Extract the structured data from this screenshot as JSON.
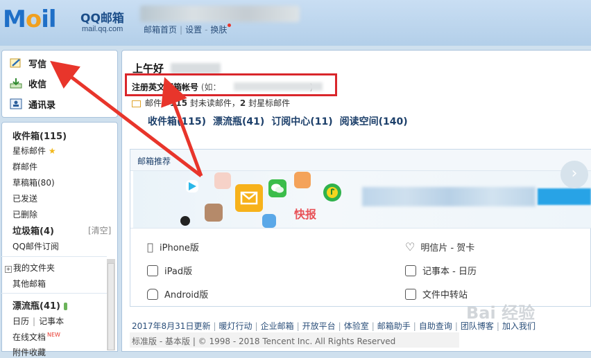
{
  "header": {
    "logo_text_main": "M",
    "logo_text_o": "o",
    "logo_text_il": "il",
    "logo_qq": "QQ邮箱",
    "logo_url": "mail.qq.com",
    "nav": {
      "home": "邮箱首页",
      "settings": "设置",
      "skin": "换肤"
    }
  },
  "sidebar": {
    "write": "写信",
    "receive": "收信",
    "contacts": "通讯录",
    "folders": [
      {
        "label": "收件箱(115)",
        "bold": true
      },
      {
        "label": "星标邮件",
        "bold": false
      },
      {
        "label": "群邮件",
        "bold": false
      },
      {
        "label": "草稿箱(80)",
        "bold": false
      },
      {
        "label": "已发送",
        "bold": false
      },
      {
        "label": "已删除",
        "bold": false
      },
      {
        "label": "垃圾箱(4)",
        "bold": true
      },
      {
        "label": "QQ邮件订阅",
        "bold": false
      }
    ],
    "clear_label": "[清空]",
    "my_folders": "我的文件夹",
    "other_mailbox": "其他邮箱",
    "drift_bottle": "漂流瓶(41)",
    "calendar": "日历",
    "notes": "记事本",
    "online_docs": "在线文档",
    "new_badge": "NEW",
    "attachments": "附件收藏"
  },
  "main": {
    "greeting": "上午好",
    "register_prefix": "注册英文邮箱帐号",
    "register_hint": "(如：",
    "register_suffix": ")",
    "mail_stat_prefix": "邮件：",
    "unread_count": "115",
    "unread_text": "封未读邮件，",
    "star_count": "2",
    "star_text": "封星标邮件",
    "quick_links": [
      "收件箱(115)",
      "漂流瓶(41)",
      "订阅中心(11)",
      "阅读空间(140)"
    ],
    "promo_title": "邮箱推荐",
    "kuaibao": "快报",
    "downloads": {
      "left": [
        "iPhone版",
        "iPad版",
        "Android版"
      ],
      "right": [
        "明信片 - 贺卡",
        "记事本 - 日历",
        "文件中转站"
      ]
    }
  },
  "footer": {
    "links": [
      "2017年8月31日更新",
      "暖灯行动",
      "企业邮箱",
      "开放平台",
      "体验室",
      "邮箱助手",
      "自助查询",
      "团队博客",
      "加入我们"
    ],
    "line2_a": "标准版",
    "line2_b": "基本版",
    "copyright": "© 1998 - 2018 Tencent Inc. All Rights Reserved"
  },
  "watermark": "Bai 经验",
  "colors": {
    "accent": "#1c3f6a",
    "highlight_red": "#d9262b",
    "header_bg": "#c9def3"
  }
}
